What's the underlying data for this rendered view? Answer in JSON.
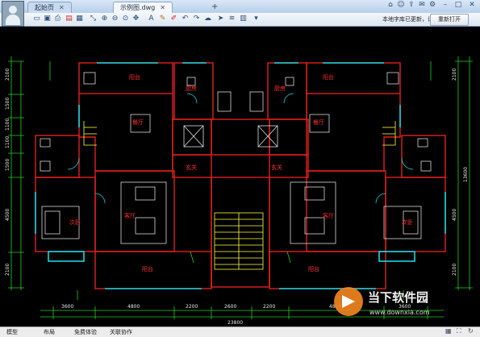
{
  "app": {
    "tabs": [
      {
        "label": "起始页",
        "active": false
      },
      {
        "label": "示例图.dwg",
        "active": true
      }
    ],
    "notice": "本地字库已更新，请",
    "reopen_label": "重新打开"
  },
  "toolbar_icons": [
    "folder-open-icon",
    "save-icon",
    "print-icon",
    "pdf-icon",
    "image-export-icon",
    "measure-icon",
    "zoom-window-icon",
    "zoom-out-icon",
    "zoom-all-icon",
    "pan-icon",
    "undo-icon",
    "redo-icon",
    "text-icon",
    "pencil-icon",
    "highlighter-icon",
    "cloud-markup-icon",
    "arrow-icon",
    "layers-icon",
    "layout-icon",
    "tools-icon"
  ],
  "status": {
    "items": [
      "模型",
      "布局",
      "免费体验",
      "关联协作"
    ]
  },
  "drawing": {
    "rooms": {
      "balcony": "阳台",
      "kitchen": "厨房",
      "dining": "餐厅",
      "hall": "玄关",
      "living": "客厅",
      "bedroom": "次卧"
    },
    "dim_bottom": [
      "3600",
      "4800",
      "2200",
      "2600",
      "2200",
      "4800",
      "3600"
    ],
    "dim_total": "23800",
    "dim_left": [
      "2100",
      "1500",
      "1100",
      "1100",
      "1500",
      "4500",
      "2100"
    ],
    "dim_right_total": "13600"
  },
  "watermark": {
    "brand": "当下软件园",
    "url": "www.downxia.com"
  },
  "colors": {
    "background": "#000000",
    "wall": "#e02020",
    "dimension": "#1fd11f",
    "text": "#ff3030",
    "window": "#19d6e0",
    "furniture": "#d8d8d8",
    "stair": "#ffff3a"
  }
}
